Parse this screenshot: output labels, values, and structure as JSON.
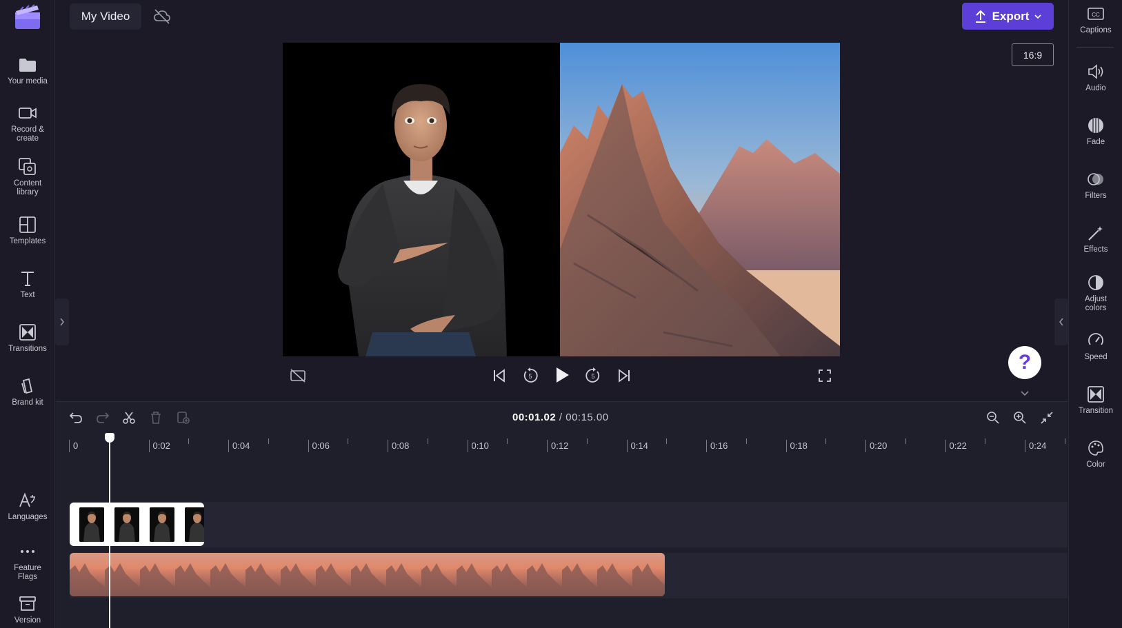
{
  "app": {
    "project_title": "My Video",
    "export_label": "Export",
    "aspect_ratio": "16:9",
    "accent_color": "#5b3fd6"
  },
  "left_sidebar": {
    "items": [
      {
        "label": "Your media",
        "icon": "folder-icon"
      },
      {
        "label": "Record &\ncreate",
        "icon": "camera-icon"
      },
      {
        "label": "Content\nlibrary",
        "icon": "library-icon"
      },
      {
        "label": "Templates",
        "icon": "templates-icon"
      },
      {
        "label": "Text",
        "icon": "text-icon"
      },
      {
        "label": "Transitions",
        "icon": "transitions-icon"
      },
      {
        "label": "Brand kit",
        "icon": "brand-kit-icon"
      },
      {
        "label": "Languages",
        "icon": "languages-icon"
      },
      {
        "label": "Feature\nFlags",
        "icon": "more-icon"
      },
      {
        "label": "Version",
        "icon": "archive-icon"
      }
    ]
  },
  "right_sidebar": {
    "items": [
      {
        "label": "Captions",
        "icon": "captions-icon"
      },
      {
        "label": "Audio",
        "icon": "speaker-icon"
      },
      {
        "label": "Fade",
        "icon": "fade-icon"
      },
      {
        "label": "Filters",
        "icon": "filters-icon"
      },
      {
        "label": "Effects",
        "icon": "magic-wand-icon"
      },
      {
        "label": "Adjust\ncolors",
        "icon": "contrast-icon"
      },
      {
        "label": "Speed",
        "icon": "speedometer-icon"
      },
      {
        "label": "Transition",
        "icon": "transition-icon"
      },
      {
        "label": "Color",
        "icon": "palette-icon"
      }
    ]
  },
  "player": {
    "controls": [
      "captions-off-icon",
      "skip-back-icon",
      "rewind-5-icon",
      "play-icon",
      "forward-5-icon",
      "skip-forward-icon",
      "fullscreen-icon"
    ]
  },
  "timeline": {
    "current_time": "00:01.02",
    "total_time": "/ 00:15.00",
    "ruler_labels": [
      "0",
      "0:02",
      "0:04",
      "0:06",
      "0:08",
      "0:10",
      "0:12",
      "0:14",
      "0:16",
      "0:18",
      "0:20",
      "0:22",
      "0:24"
    ],
    "tools": [
      "undo-icon",
      "redo-icon",
      "split-icon",
      "delete-icon",
      "add-to-media-icon"
    ],
    "zoom_tools": [
      "zoom-out-icon",
      "zoom-in-icon",
      "fit-icon"
    ],
    "tracks": [
      {
        "name": "avatar-clip",
        "frames": 4
      },
      {
        "name": "mountain-clip",
        "frames": 17
      }
    ]
  },
  "help": {
    "label": "?"
  }
}
